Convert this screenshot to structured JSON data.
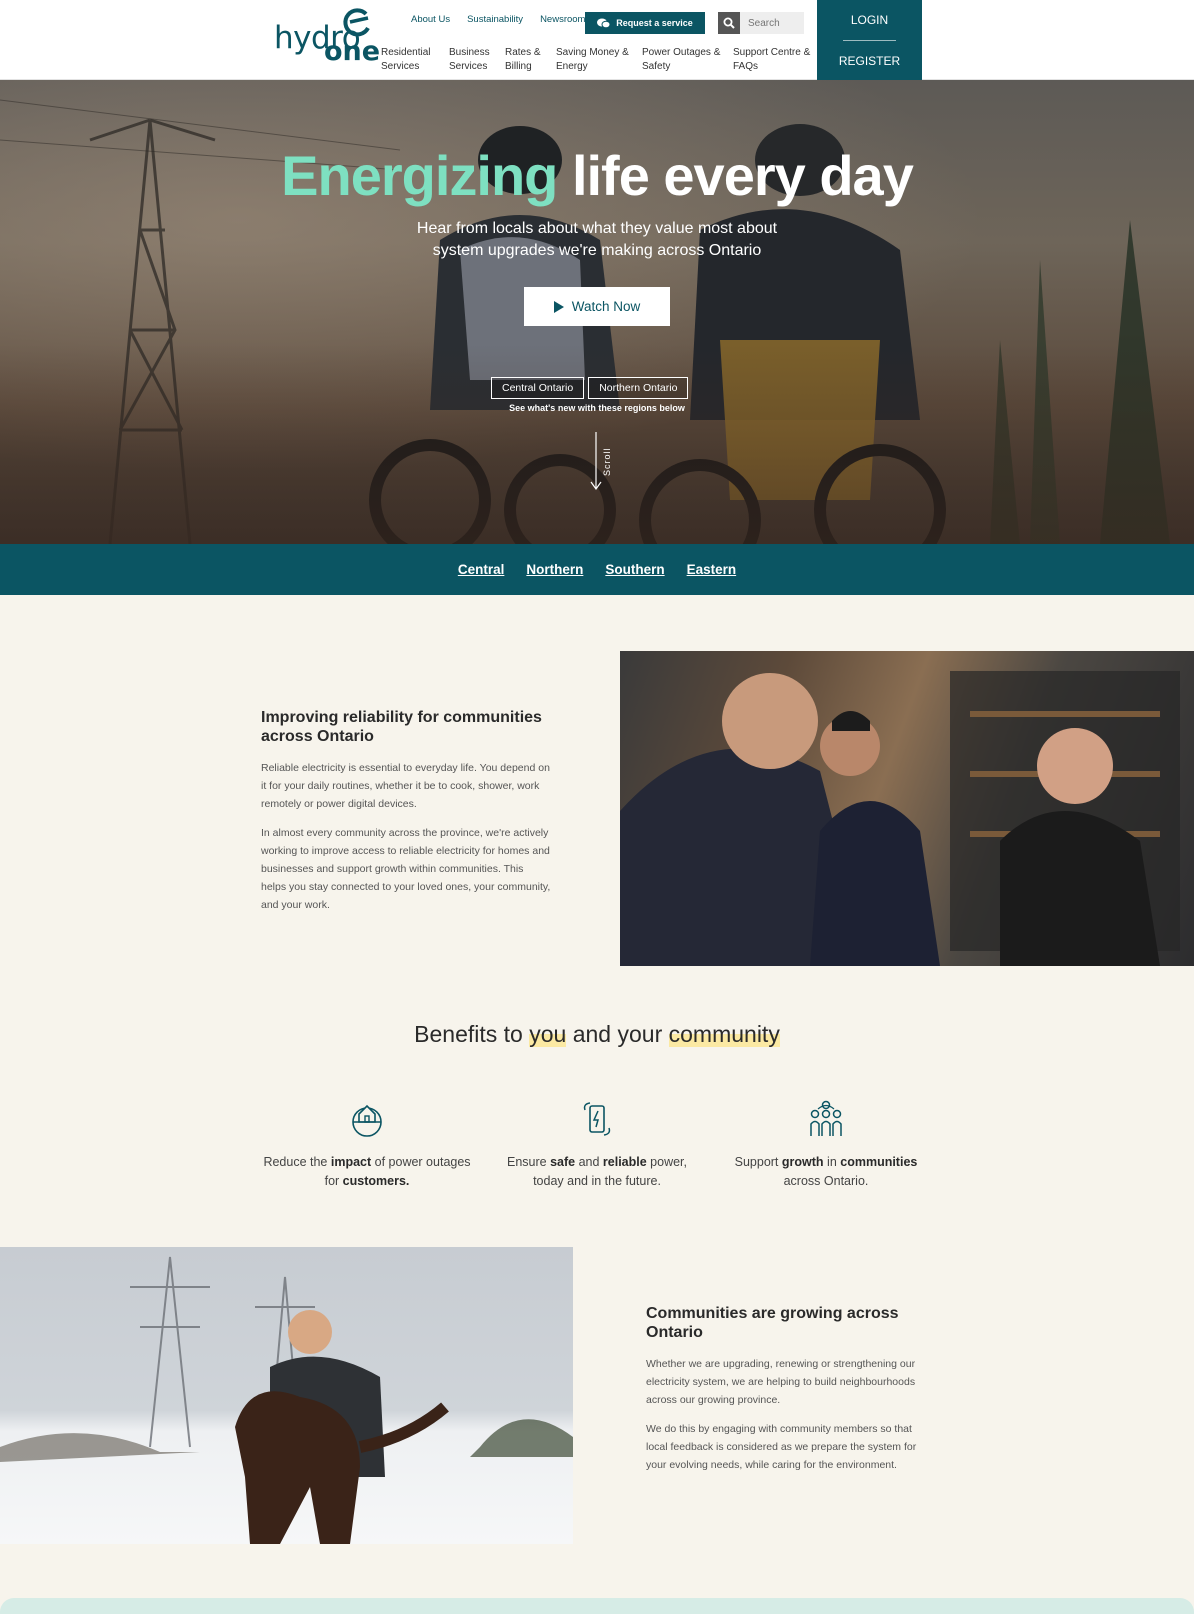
{
  "header": {
    "logo": {
      "line1": "hydro",
      "line2": "one"
    },
    "utility_links": [
      "About Us",
      "Sustainability",
      "Newsroom"
    ],
    "request_button": "Request a service",
    "search_placeholder": "Search",
    "nav": [
      {
        "line1": "Residential",
        "line2": "Services"
      },
      {
        "line1": "Business",
        "line2": "Services"
      },
      {
        "line1": "Rates &",
        "line2": "Billing"
      },
      {
        "line1": "Saving Money &",
        "line2": "Energy"
      },
      {
        "line1": "Power Outages &",
        "line2": "Safety"
      },
      {
        "line1": "Support Centre &",
        "line2": "FAQs"
      }
    ],
    "login": "LOGIN",
    "register": "REGISTER"
  },
  "hero": {
    "title_accent": "Energizing",
    "title_rest": "life every day",
    "subtitle": "Hear from locals about what they value most about system upgrades we're making across Ontario",
    "watch_button": "Watch Now",
    "region_buttons": [
      "Central Ontario",
      "Northern Ontario"
    ],
    "region_note": "See what's new with these regions below",
    "scroll_label": "Scroll"
  },
  "region_bar": [
    "Central",
    "Northern",
    "Southern",
    "Eastern"
  ],
  "section_reliability": {
    "heading": "Improving reliability for communities across Ontario",
    "p1": "Reliable electricity is essential to everyday life. You depend on it for your daily routines, whether it be to cook, shower, work remotely or power digital devices.",
    "p2": "In almost every community across the province, we're actively working to improve access to reliable electricity for homes and businesses and support growth within communities. This helps you stay connected to your loved ones, your community, and your work."
  },
  "benefits": {
    "title_parts": [
      "Benefits to ",
      "you",
      " and your ",
      "community"
    ],
    "items": [
      {
        "icon": "house-globe-icon",
        "parts": [
          "Reduce the ",
          "impact",
          " of power outages for ",
          "customers."
        ]
      },
      {
        "icon": "battery-refresh-icon",
        "parts": [
          "Ensure ",
          "safe",
          " and ",
          "reliable",
          " power, today and in the future."
        ]
      },
      {
        "icon": "community-people-icon",
        "parts": [
          "Support ",
          "growth",
          " in ",
          "communities",
          " across Ontario."
        ]
      }
    ]
  },
  "section_growing": {
    "heading": "Communities are growing across Ontario",
    "p1": "Whether we are upgrading, renewing or strengthening our electricity system, we are helping to build neighbourhoods across our growing province.",
    "p2": "We do this by engaging with community members so that local feedback is considered as we prepare the system for your evolving needs, while caring for the environment."
  },
  "colors": {
    "brand": "#0b5563",
    "accent": "#7ee0c1",
    "highlight": "#fbe9a3",
    "background": "#f7f4ec"
  }
}
